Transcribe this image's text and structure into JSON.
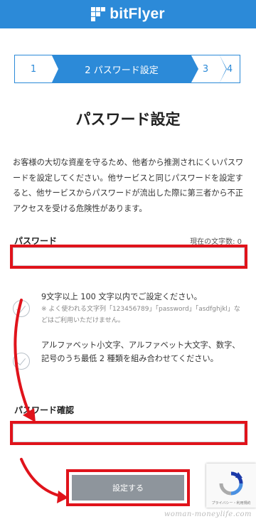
{
  "header": {
    "brand": "bitFlyer",
    "logo_icon": "bitflyer-logo-icon",
    "color": "#2c8ad8"
  },
  "stepper": {
    "steps": [
      "1",
      "2 パスワード設定",
      "3",
      "4"
    ],
    "active_index": 1
  },
  "page": {
    "title": "パスワード設定"
  },
  "intro": "お客様の大切な資産を守るため、他者から推測されにくいパスワードを設定してください。他サービスと同じパスワードを設定すると、他サービスからパスワードが流出した際に第三者から不正アクセスを受ける危険性があります。",
  "password": {
    "label": "パスワード",
    "char_count_label": "現在の文字数: 0",
    "value": ""
  },
  "rules": [
    {
      "text": "9文字以上 100 文字以内でご設定ください。",
      "note": "※ よく使われる文字列「123456789」「password」「asdfghjkl」などはご利用いただけません。",
      "icon": "check-circle-icon"
    },
    {
      "text": "アルファベット小文字、アルファベット大文字、数字、記号のうち最低 2 種類を組み合わせてください。",
      "note": "",
      "icon": "check-circle-icon"
    }
  ],
  "confirm": {
    "label": "パスワード確認",
    "value": ""
  },
  "submit": {
    "label": "設定する"
  },
  "recaptcha": {
    "note": "プライバシー・利用規約",
    "icon": "recaptcha-icon"
  },
  "watermark": "woman-moneylife.com",
  "colors": {
    "accent": "#2c8ad8",
    "highlight": "#e0131b",
    "button": "#8e959c"
  }
}
